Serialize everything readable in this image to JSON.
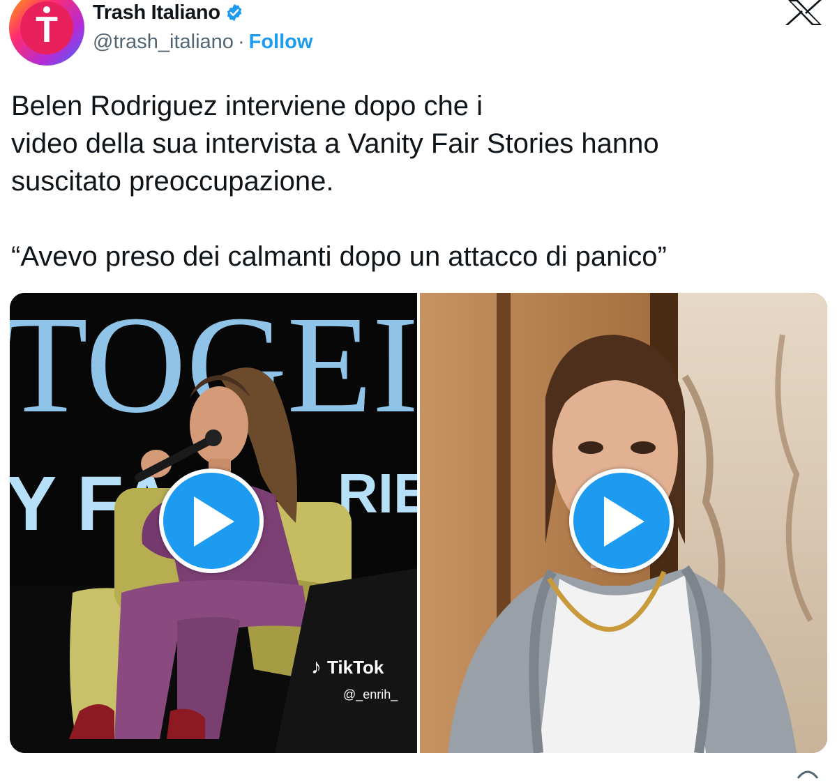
{
  "author": {
    "display_name": "Trash Italiano",
    "handle": "@trash_italiano",
    "separator": "·",
    "follow_label": "Follow",
    "avatar_letter": "T",
    "verified": true
  },
  "platform": {
    "logo": "x-logo"
  },
  "tweet": {
    "lines": [
      "Belen Rodriguez interviene dopo che i",
      "video della sua intervista a Vanity Fair Stories hanno",
      "suscitato preoccupazione."
    ],
    "quote": "“Avevo preso dei calmanti dopo un attacco di panico”"
  },
  "media": {
    "left_video": {
      "backdrop_text_1": "TOGEI",
      "backdrop_text_2": "Y FA",
      "backdrop_text_3": "RIE",
      "watermark": "TikTok",
      "watermark_handle": "@_enrih_"
    }
  },
  "colors": {
    "accent": "#1d9bf0",
    "text": "#0f1419",
    "secondary_text": "#536471"
  }
}
